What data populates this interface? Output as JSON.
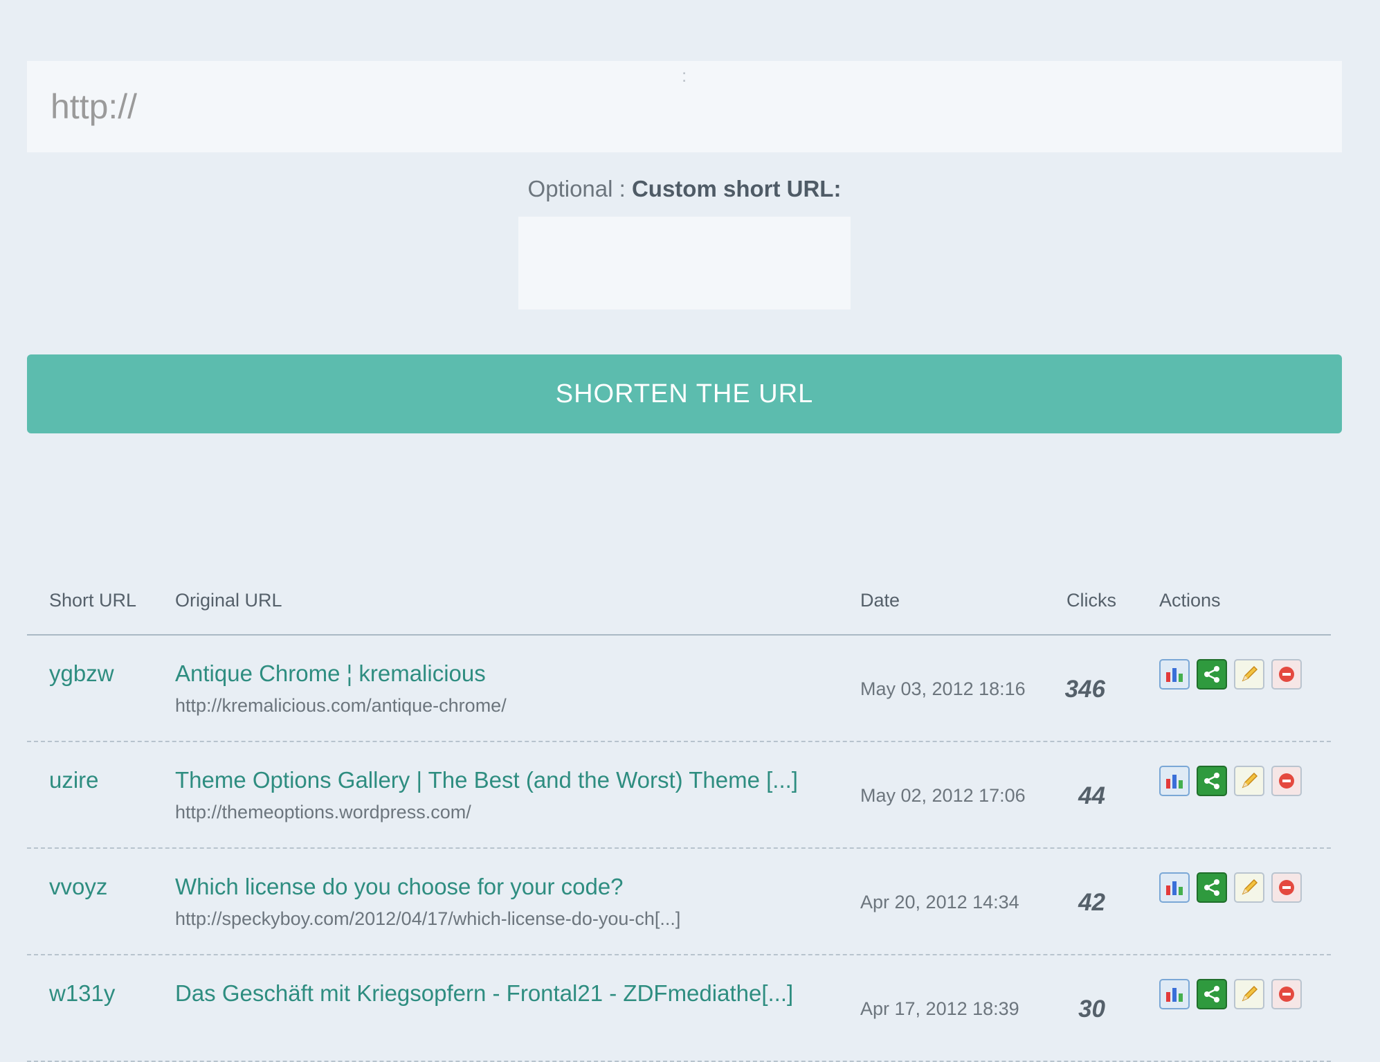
{
  "form": {
    "url_placeholder": "http://",
    "custom_label_optional": "Optional :",
    "custom_label_main": "Custom short URL:",
    "custom_value": "",
    "submit_label": "SHORTEN THE URL"
  },
  "table": {
    "headers": {
      "short_url": "Short URL",
      "original_url": "Original URL",
      "date": "Date",
      "clicks": "Clicks",
      "actions": "Actions"
    },
    "rows": [
      {
        "short": "ygbzw",
        "title": "Antique Chrome ¦ kremalicious",
        "url": "http://kremalicious.com/antique-chrome/",
        "date": "May 03, 2012 18:16",
        "clicks": "346"
      },
      {
        "short": "uzire",
        "title": "Theme Options Gallery | The Best (and the Worst) Theme [...]",
        "url": "http://themeoptions.wordpress.com/",
        "date": "May 02, 2012 17:06",
        "clicks": "44"
      },
      {
        "short": "vvoyz",
        "title": "Which license do you choose for your code?",
        "url": "http://speckyboy.com/2012/04/17/which-license-do-you-ch[...]",
        "date": "Apr 20, 2012 14:34",
        "clicks": "42"
      },
      {
        "short": "w131y",
        "title": "Das Geschäft mit Kriegsopfern - Frontal21 - ZDFmediathe[...]",
        "url": "",
        "date": "Apr 17, 2012 18:39",
        "clicks": "30"
      }
    ]
  },
  "icons": {
    "stats": "bar-chart-icon",
    "share": "share-icon",
    "edit": "pencil-icon",
    "delete": "delete-icon"
  },
  "colors": {
    "background": "#e8eef4",
    "accent": "#5cbcae",
    "link": "#2e8d80"
  }
}
